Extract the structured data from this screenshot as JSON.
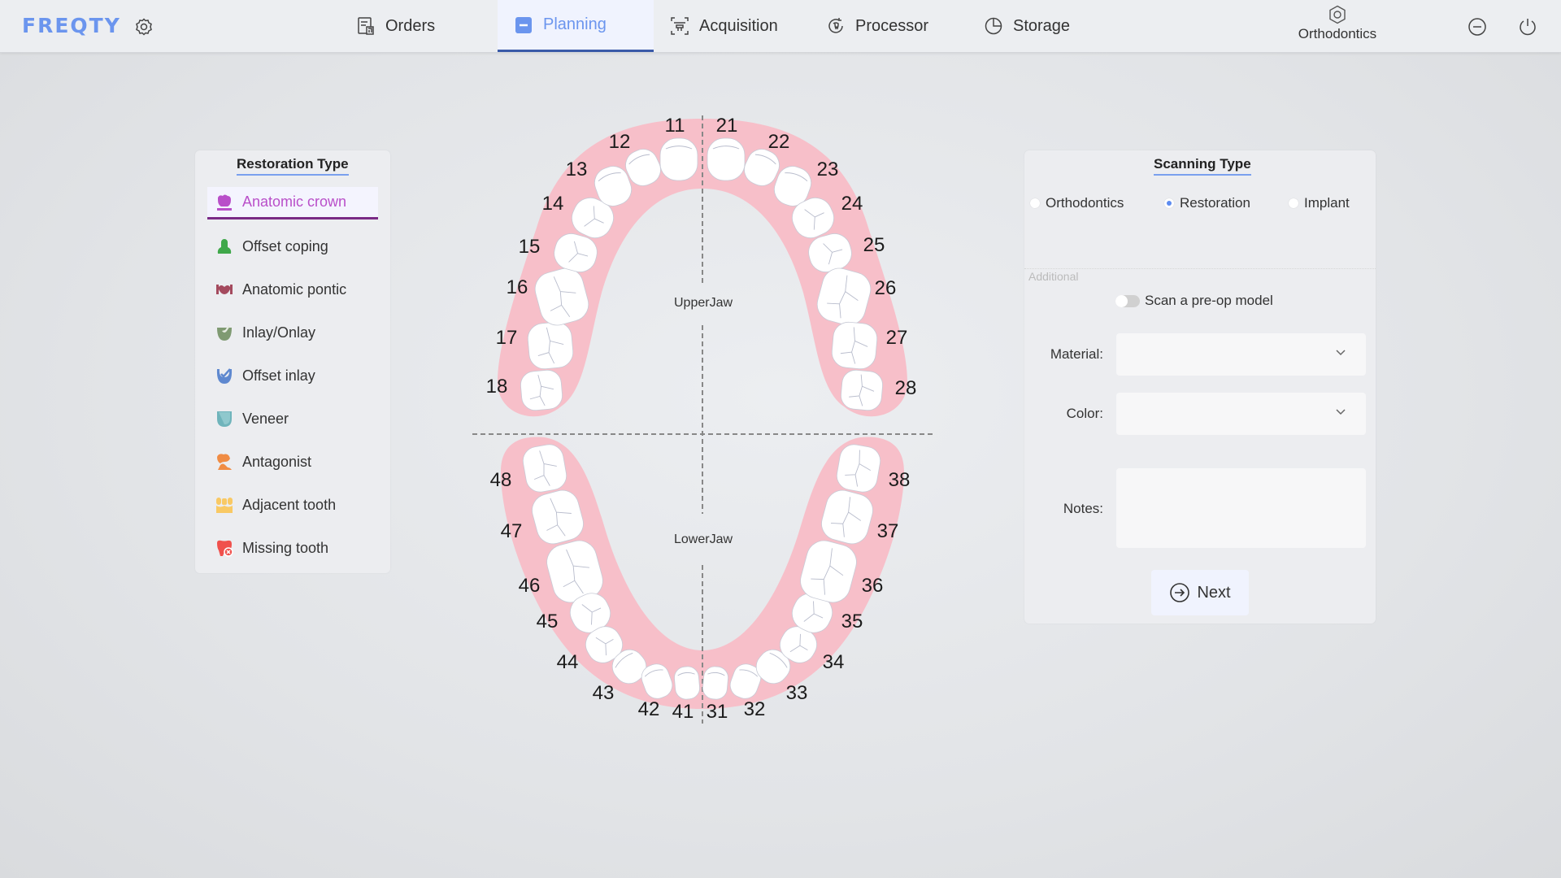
{
  "app": {
    "logo": "FREQTY",
    "brand_color": "#6b95ee"
  },
  "nav": {
    "tabs": [
      {
        "label": "Orders",
        "icon": "orders-icon",
        "active": false
      },
      {
        "label": "Planning",
        "icon": "planning-icon",
        "active": true
      },
      {
        "label": "Acquisition",
        "icon": "acquisition-icon",
        "active": false
      },
      {
        "label": "Processor",
        "icon": "processor-icon",
        "active": false
      },
      {
        "label": "Storage",
        "icon": "storage-icon",
        "active": false
      }
    ],
    "profile_label": "Orthodontics"
  },
  "restoration_panel": {
    "title": "Restoration Type",
    "items": [
      {
        "label": "Anatomic crown",
        "icon": "anatomic-crown-icon",
        "color": "#b94fc9",
        "active": true
      },
      {
        "label": "Offset coping",
        "icon": "offset-coping-icon",
        "color": "#3fa84a",
        "active": false
      },
      {
        "label": "Anatomic pontic",
        "icon": "anatomic-pontic-icon",
        "color": "#a44a5e",
        "active": false
      },
      {
        "label": "Inlay/Onlay",
        "icon": "inlay-onlay-icon",
        "color": "#7f9a72",
        "active": false
      },
      {
        "label": "Offset inlay",
        "icon": "offset-inlay-icon",
        "color": "#5e88cf",
        "active": false
      },
      {
        "label": "Veneer",
        "icon": "veneer-icon",
        "color": "#6fb4bb",
        "active": false
      },
      {
        "label": "Antagonist",
        "icon": "antagonist-icon",
        "color": "#f08c44",
        "active": false
      },
      {
        "label": "Adjacent tooth",
        "icon": "adjacent-tooth-icon",
        "color": "#f9c964",
        "active": false
      },
      {
        "label": "Missing tooth",
        "icon": "missing-tooth-icon",
        "color": "#f0504c",
        "active": false
      }
    ]
  },
  "dental_chart": {
    "upper_label": "UpperJaw",
    "lower_label": "LowerJaw",
    "upper_teeth": [
      "18",
      "17",
      "16",
      "15",
      "14",
      "13",
      "12",
      "11",
      "21",
      "22",
      "23",
      "24",
      "25",
      "26",
      "27",
      "28"
    ],
    "lower_teeth": [
      "48",
      "47",
      "46",
      "45",
      "44",
      "43",
      "42",
      "41",
      "31",
      "32",
      "33",
      "34",
      "35",
      "36",
      "37",
      "38"
    ],
    "gum_color": "#f7bfc9",
    "tooth_color": "#ffffff"
  },
  "scanning_panel": {
    "title": "Scanning Type",
    "options": [
      {
        "label": "Orthodontics",
        "selected": false
      },
      {
        "label": "Restoration",
        "selected": true
      },
      {
        "label": "Implant",
        "selected": false
      }
    ],
    "additional_label": "Additional",
    "toggle_label": "Scan a pre-op model",
    "toggle_on": false,
    "material_label": "Material:",
    "material_value": "",
    "color_label": "Color:",
    "color_value": "",
    "notes_label": "Notes:",
    "notes_value": "",
    "next_label": "Next"
  }
}
